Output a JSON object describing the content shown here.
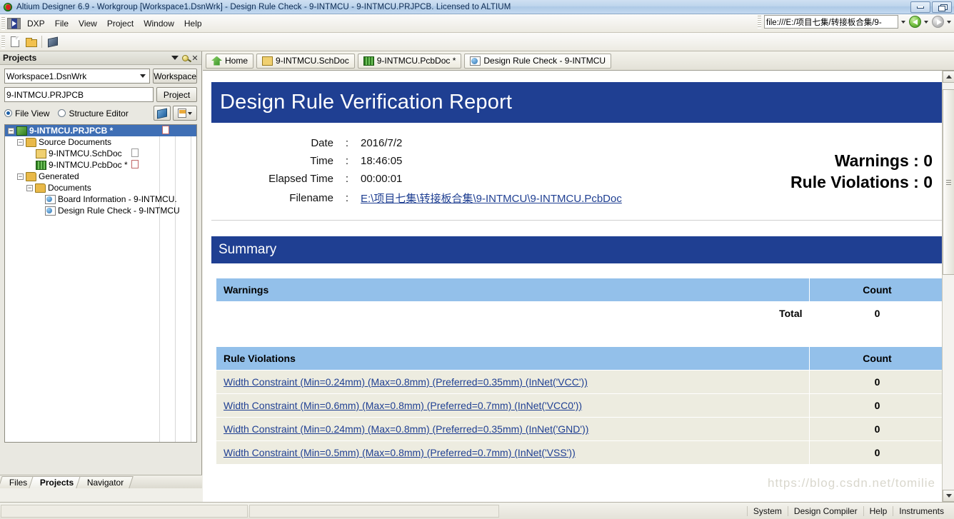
{
  "window": {
    "title": "Altium Designer 6.9 - Workgroup [Workspace1.DsnWrk] - Design Rule Check - 9-INTMCU - 9-INTMCU.PRJPCB. Licensed to ALTIUM",
    "minimize_label": "Minimize",
    "restore_label": "Restore"
  },
  "menu": {
    "items": [
      "DXP",
      "File",
      "View",
      "Project",
      "Window",
      "Help"
    ]
  },
  "address_bar": {
    "value": "file:///E:/项目七集/转接板合集/9-",
    "back_label": "Back",
    "forward_label": "Forward"
  },
  "toolbar": {
    "new_label": "New",
    "open_label": "Open",
    "pcb_label": "PCB"
  },
  "projects_panel": {
    "title": "Projects",
    "workspace_value": "Workspace1.DsnWrk",
    "workspace_button": "Workspace",
    "project_value": "9-INTMCU.PRJPCB",
    "project_button": "Project",
    "view_options": [
      "File View",
      "Structure Editor"
    ],
    "selected_view": "File View",
    "tree": [
      {
        "label": "9-INTMCU.PRJPCB *",
        "level": 0,
        "icon": "project-icon",
        "expander": "-",
        "selected": true
      },
      {
        "label": "Source Documents",
        "level": 1,
        "icon": "folder-icon",
        "expander": "-",
        "selected": false
      },
      {
        "label": "9-INTMCU.SchDoc",
        "level": 2,
        "icon": "schematic-icon",
        "expander": "",
        "selected": false
      },
      {
        "label": "9-INTMCU.PcbDoc *",
        "level": 2,
        "icon": "pcb-icon",
        "expander": "",
        "selected": false
      },
      {
        "label": "Generated",
        "level": 1,
        "icon": "folder-icon",
        "expander": "-",
        "selected": false
      },
      {
        "label": "Documents",
        "level": 2,
        "icon": "folder-icon",
        "expander": "-",
        "selected": false
      },
      {
        "label": "Board Information - 9-INTMCU.",
        "level": 3,
        "icon": "report-icon",
        "expander": "",
        "selected": false
      },
      {
        "label": "Design Rule Check - 9-INTMCU",
        "level": 3,
        "icon": "report-icon",
        "expander": "",
        "selected": false
      }
    ],
    "bottom_tabs": [
      {
        "label": "Files",
        "active": false
      },
      {
        "label": "Projects",
        "active": true
      },
      {
        "label": "Navigator",
        "active": false
      }
    ]
  },
  "document_tabs": [
    {
      "label": "Home",
      "icon": "home-icon",
      "active": false
    },
    {
      "label": "9-INTMCU.SchDoc",
      "icon": "schematic-icon",
      "active": false
    },
    {
      "label": "9-INTMCU.PcbDoc *",
      "icon": "pcb-icon",
      "active": false
    },
    {
      "label": "Design Rule Check - 9-INTMCU",
      "icon": "report-icon",
      "active": true
    }
  ],
  "report": {
    "title": "Design Rule Verification Report",
    "meta": [
      {
        "label": "Date",
        "sep": ":",
        "value": "2016/7/2",
        "link": false
      },
      {
        "label": "Time",
        "sep": ":",
        "value": "18:46:05",
        "link": false
      },
      {
        "label": "Elapsed Time",
        "sep": ":",
        "value": "00:00:01",
        "link": false
      },
      {
        "label": "Filename",
        "sep": ":",
        "value": "E:\\项目七集\\转接板合集\\9-INTMCU\\9-INTMCU.PcbDoc",
        "link": true
      }
    ],
    "warnings_summary": "Warnings : 0",
    "violations_summary": "Rule Violations : 0",
    "summary_heading": "Summary",
    "warnings_table": {
      "header_label": "Warnings",
      "count_label": "Count",
      "total_label": "Total",
      "total_value": "0"
    },
    "violations_table": {
      "header_label": "Rule Violations",
      "count_label": "Count",
      "rows": [
        {
          "rule": "Width Constraint (Min=0.24mm) (Max=0.8mm) (Preferred=0.35mm) (InNet('VCC'))",
          "count": "0"
        },
        {
          "rule": "Width Constraint (Min=0.6mm) (Max=0.8mm) (Preferred=0.7mm) (InNet('VCC0'))",
          "count": "0"
        },
        {
          "rule": "Width Constraint (Min=0.24mm) (Max=0.8mm) (Preferred=0.35mm) (InNet('GND'))",
          "count": "0"
        },
        {
          "rule": "Width Constraint (Min=0.5mm) (Max=0.8mm) (Preferred=0.7mm) (InNet('VSS'))",
          "count": "0"
        }
      ]
    },
    "colors": {
      "header_blue": "#1f3f92",
      "table_header_blue": "#93c0ea",
      "row_cream": "#edece0",
      "link_blue": "#1f3f92"
    },
    "watermark": "https://blog.csdn.net/tomilie"
  },
  "status_bar": {
    "items": [
      "System",
      "Design Compiler",
      "Help",
      "Instruments"
    ]
  }
}
